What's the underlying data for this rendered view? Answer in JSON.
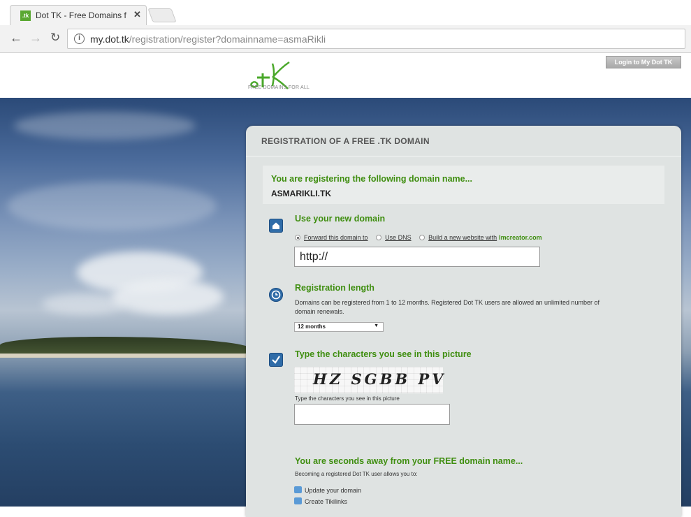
{
  "browser": {
    "tab_title": "Dot TK - Free Domains fo",
    "url_host": "my.dot.tk",
    "url_path": "/registration/register?domainname=asmaRikli"
  },
  "header": {
    "logo_tagline": "FREE DOMAINS FOR ALL",
    "login_button": "Login to My Dot TK"
  },
  "panel": {
    "title": "REGISTRATION OF A FREE .TK DOMAIN",
    "registering_heading": "You are registering the following domain name...",
    "domain_name": "ASMARIKLI.TK",
    "use_domain": {
      "title": "Use your new domain",
      "options": [
        "Forward this domain to",
        "Use DNS",
        "Build a new website with"
      ],
      "brand": "Imcreator.com",
      "url_value": "http://"
    },
    "registration_length": {
      "title": "Registration length",
      "description": "Domains can be registered from 1 to 12 months. Registered Dot TK users are allowed an unlimited number of",
      "description_2": "domain renewals.",
      "selected": "12 months"
    },
    "captcha": {
      "title": "Type the characters you see in this picture",
      "image_text": "HZ SGBB PV",
      "label": "Type the characters you see in this picture"
    },
    "seconds_away": {
      "title": "You are seconds away from your FREE domain name...",
      "subtitle": "Becoming a registered Dot TK user allows you to:",
      "benefits": [
        "Update your domain",
        "Create Tikilinks"
      ]
    }
  },
  "colors": {
    "accent_green": "#3f8e10",
    "icon_blue": "#2f6ca8"
  }
}
